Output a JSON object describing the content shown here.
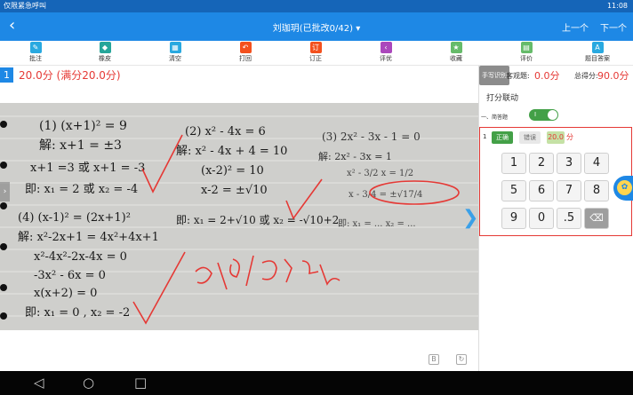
{
  "status": {
    "left": "仅限紧急呼叫",
    "right": "11:08"
  },
  "appbar": {
    "back_icon": "‹",
    "title": "刘珈玥(已批改0/42)",
    "dropdown_icon": "▾",
    "prev": "上一个",
    "next": "下一个"
  },
  "toolbar": [
    {
      "label": "批注",
      "icon": "pencil-icon",
      "color": "#29a9e0"
    },
    {
      "label": "橡皮",
      "icon": "eraser-icon",
      "color": "#26a69a"
    },
    {
      "label": "清空",
      "icon": "clear-icon",
      "color": "#29a9e0"
    },
    {
      "label": "打回",
      "icon": "return-icon",
      "color": "#f4511e"
    },
    {
      "label": "订正",
      "icon": "correct-icon",
      "color": "#f4511e"
    },
    {
      "label": "评优",
      "icon": "share-icon",
      "color": "#ab47bc"
    },
    {
      "label": "收藏",
      "icon": "star-icon",
      "color": "#66bb6a"
    },
    {
      "label": "评价",
      "icon": "comment-icon",
      "color": "#66bb6a"
    },
    {
      "label": "题目答案",
      "icon": "answer-icon",
      "color": "#29a9e0"
    }
  ],
  "question": {
    "number": "1",
    "score_text": "20.0分 (满分20.0分)"
  },
  "panel": {
    "handwriting_label": "手写识别",
    "objective_label": "客观题:",
    "objective_score": "0.0分",
    "total_label": "总得分:",
    "total_score": "90.0分",
    "linkage_label": "打分联动",
    "toggle_text": "I",
    "section_title": "一、简答题"
  },
  "grade": {
    "index": "1",
    "correct": "正确",
    "wrong": "错误",
    "score": "20.0",
    "unit": "分"
  },
  "keypad": [
    "1",
    "2",
    "3",
    "4",
    "5",
    "6",
    "7",
    "8",
    "9",
    "0",
    ".5",
    "⌫"
  ],
  "nav": {
    "back": "◁",
    "home": "○",
    "recent": "□"
  }
}
